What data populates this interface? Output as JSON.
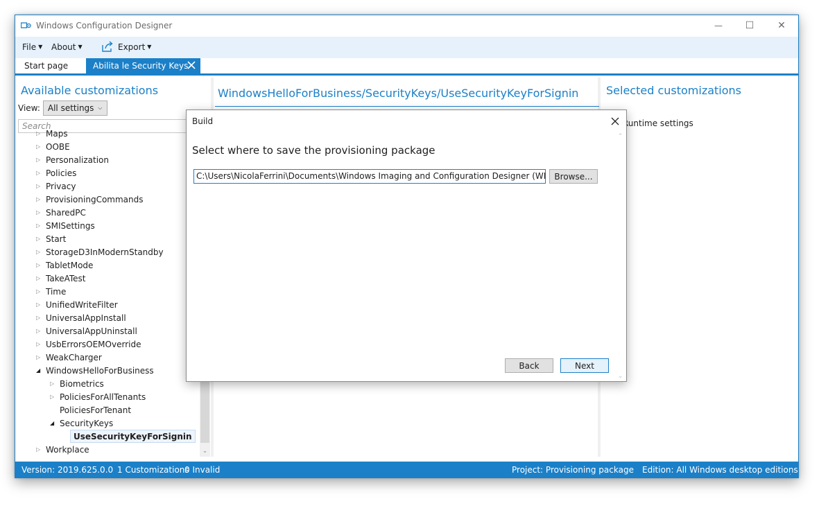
{
  "window": {
    "title": "Windows Configuration Designer",
    "controls": {
      "minimize": "—",
      "maximize": "☐",
      "close": "✕"
    }
  },
  "menu": {
    "file": "File",
    "about": "About",
    "export": "Export"
  },
  "tabs": {
    "start": "Start page",
    "active": "Abilita le Security Keys"
  },
  "left_panel": {
    "title": "Available customizations",
    "view_label": "View:",
    "view_value": "All settings",
    "search_placeholder": "Search",
    "tree": [
      {
        "label": "Maps",
        "depth": 0,
        "state": "closed"
      },
      {
        "label": "OOBE",
        "depth": 0,
        "state": "closed"
      },
      {
        "label": "Personalization",
        "depth": 0,
        "state": "closed"
      },
      {
        "label": "Policies",
        "depth": 0,
        "state": "closed"
      },
      {
        "label": "Privacy",
        "depth": 0,
        "state": "closed"
      },
      {
        "label": "ProvisioningCommands",
        "depth": 0,
        "state": "closed"
      },
      {
        "label": "SharedPC",
        "depth": 0,
        "state": "closed"
      },
      {
        "label": "SMISettings",
        "depth": 0,
        "state": "closed"
      },
      {
        "label": "Start",
        "depth": 0,
        "state": "closed"
      },
      {
        "label": "StorageD3InModernStandby",
        "depth": 0,
        "state": "closed"
      },
      {
        "label": "TabletMode",
        "depth": 0,
        "state": "closed"
      },
      {
        "label": "TakeATest",
        "depth": 0,
        "state": "closed"
      },
      {
        "label": "Time",
        "depth": 0,
        "state": "closed"
      },
      {
        "label": "UnifiedWriteFilter",
        "depth": 0,
        "state": "closed"
      },
      {
        "label": "UniversalAppInstall",
        "depth": 0,
        "state": "closed"
      },
      {
        "label": "UniversalAppUninstall",
        "depth": 0,
        "state": "closed"
      },
      {
        "label": "UsbErrorsOEMOverride",
        "depth": 0,
        "state": "closed"
      },
      {
        "label": "WeakCharger",
        "depth": 0,
        "state": "closed"
      },
      {
        "label": "WindowsHelloForBusiness",
        "depth": 0,
        "state": "open"
      },
      {
        "label": "Biometrics",
        "depth": 1,
        "state": "closed"
      },
      {
        "label": "PoliciesForAllTenants",
        "depth": 1,
        "state": "closed"
      },
      {
        "label": "PoliciesForTenant",
        "depth": 1,
        "state": "leaf"
      },
      {
        "label": "SecurityKeys",
        "depth": 1,
        "state": "open"
      },
      {
        "label": "UseSecurityKeyForSignin",
        "depth": 2,
        "state": "selected"
      },
      {
        "label": "Workplace",
        "depth": 0,
        "state": "closed"
      }
    ]
  },
  "middle_panel": {
    "title": "WindowsHelloForBusiness/SecurityKeys/UseSecurityKeyForSignin"
  },
  "right_panel": {
    "title": "Selected customizations",
    "item": "Runtime settings"
  },
  "dialog": {
    "title": "Build",
    "heading": "Select where to save the provisioning package",
    "path_value": "C:\\Users\\NicolaFerrini\\Documents\\Windows Imaging and Configuration Designer (WICD)\\Abilita le Security Keys",
    "browse": "Browse...",
    "back": "Back",
    "next": "Next"
  },
  "status_bar": {
    "version": "Version: 2019.625.0.0",
    "customizations": "1 Customizations",
    "invalid": "0 Invalid",
    "project": "Project: Provisioning package",
    "edition": "Edition: All Windows desktop editions"
  },
  "colors": {
    "accent": "#1b80c8",
    "menu_bg": "#e6f1fb"
  }
}
